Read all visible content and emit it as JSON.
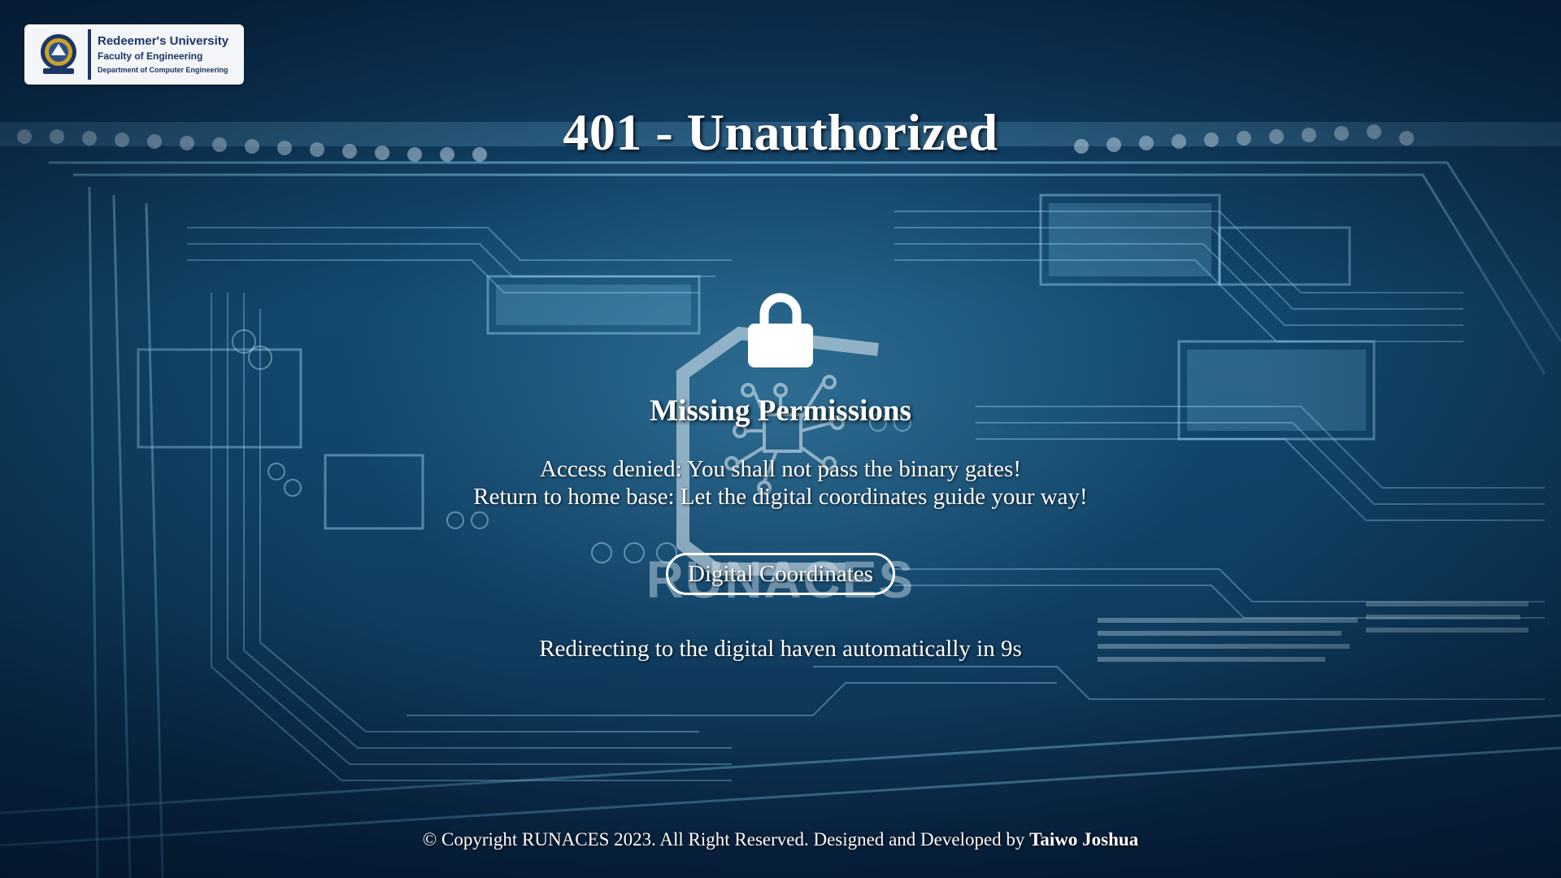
{
  "logo": {
    "university": "Redeemer's University",
    "faculty": "Faculty of Engineering",
    "department": "Department of Computer Engineering"
  },
  "heading": {
    "title": "401 - Unauthorized",
    "subtitle": "Missing Permissions"
  },
  "message": {
    "line1": "Access denied: You shall not pass the binary gates!",
    "line2": "Return to home base: Let the digital coordinates guide your way!"
  },
  "button": {
    "label": "Digital Coordinates"
  },
  "redirect": {
    "text": "Redirecting to the digital haven automatically in 9s"
  },
  "watermark": {
    "text": "RUNACES"
  },
  "footer": {
    "text": "© Copyright RUNACES 2023. All Right Reserved. Designed and Developed by",
    "author": "Taiwo Joshua"
  },
  "icons": {
    "lock": "lock-icon",
    "crest": "university-crest-icon"
  },
  "colors": {
    "background": "#0b2c4c",
    "accent": "#4a9cc8",
    "text": "#ffffff",
    "logo_text": "#1b3566"
  }
}
